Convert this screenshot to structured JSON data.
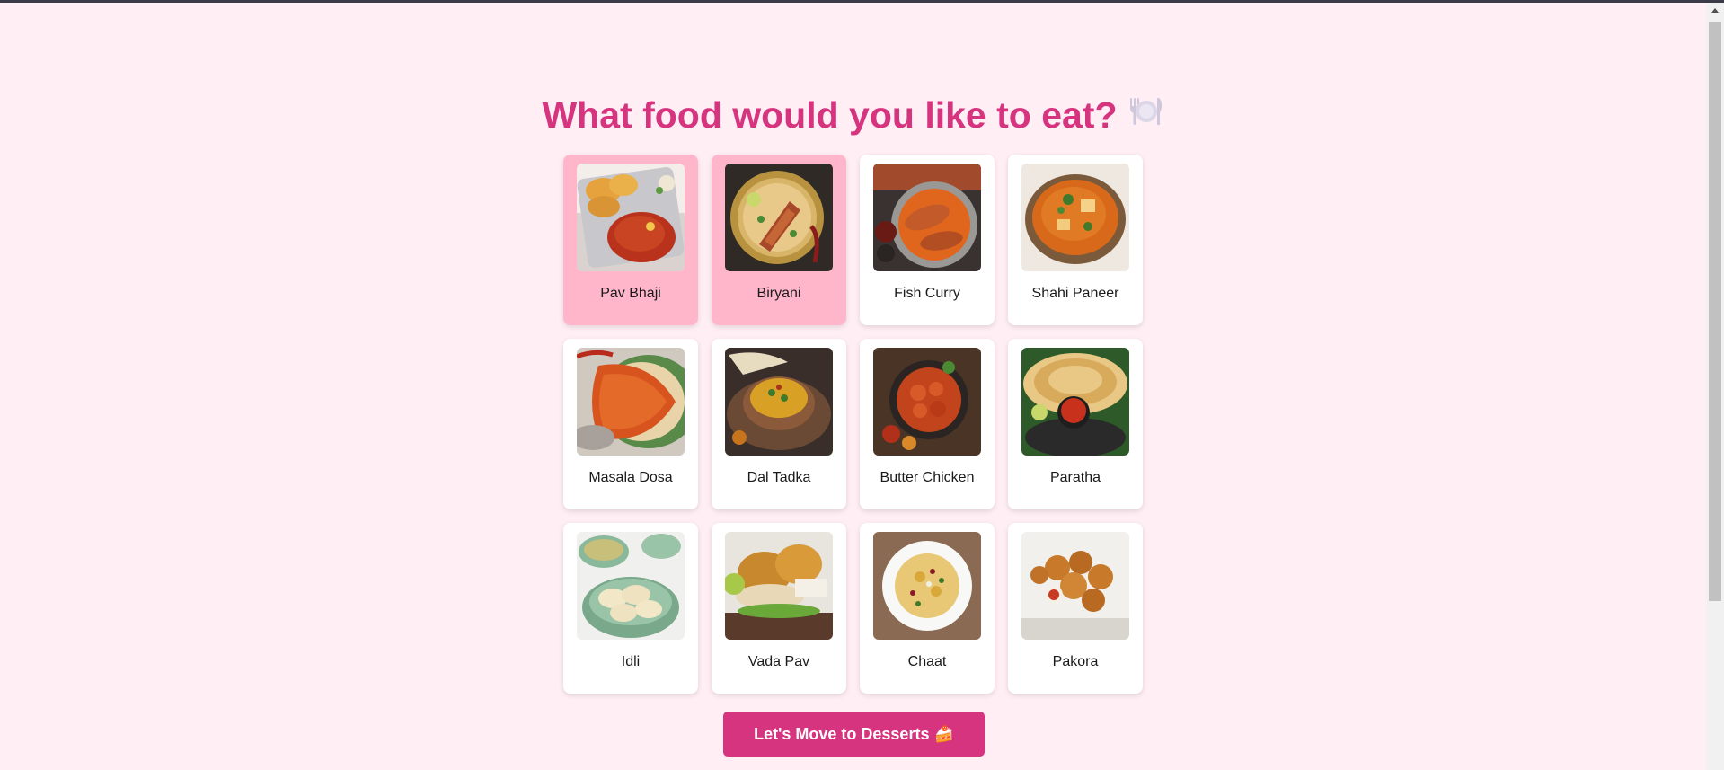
{
  "page": {
    "title": "What food would you like to eat?",
    "title_icon": "plate-cutlery-icon"
  },
  "colors": {
    "background": "#ffeef4",
    "accent": "#d6347f",
    "selected_card": "#ffb6ca",
    "card": "#ffffff"
  },
  "foods": [
    {
      "label": "Pav Bhaji",
      "selected": true,
      "icon": "pav-bhaji-image"
    },
    {
      "label": "Biryani",
      "selected": true,
      "icon": "biryani-image"
    },
    {
      "label": "Fish Curry",
      "selected": false,
      "icon": "fish-curry-image"
    },
    {
      "label": "Shahi Paneer",
      "selected": false,
      "icon": "shahi-paneer-image"
    },
    {
      "label": "Masala Dosa",
      "selected": false,
      "icon": "masala-dosa-image"
    },
    {
      "label": "Dal Tadka",
      "selected": false,
      "icon": "dal-tadka-image"
    },
    {
      "label": "Butter Chicken",
      "selected": false,
      "icon": "butter-chicken-image"
    },
    {
      "label": "Paratha",
      "selected": false,
      "icon": "paratha-image"
    },
    {
      "label": "Idli",
      "selected": false,
      "icon": "idli-image"
    },
    {
      "label": "Vada Pav",
      "selected": false,
      "icon": "vada-pav-image"
    },
    {
      "label": "Chaat",
      "selected": false,
      "icon": "chaat-image"
    },
    {
      "label": "Pakora",
      "selected": false,
      "icon": "pakora-image"
    }
  ],
  "next_button": {
    "label": "Let's Move to Desserts 🍰"
  }
}
